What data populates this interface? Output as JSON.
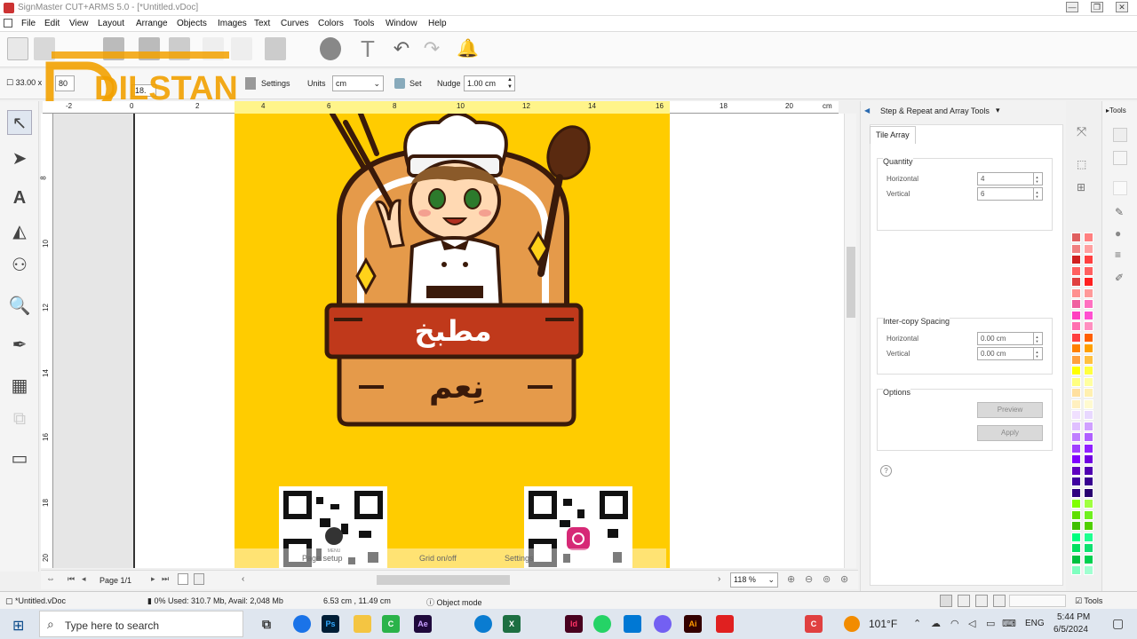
{
  "window": {
    "title": "SignMaster CUT+ARMS 5.0 - [*Untitled.vDoc]",
    "controls": [
      "—",
      "❐",
      "✕"
    ]
  },
  "menu": [
    "File",
    "Edit",
    "View",
    "Layout",
    "Arrange",
    "Objects",
    "Images",
    "Text",
    "Curves",
    "Colors",
    "Tools",
    "Window",
    "Help"
  ],
  "logo": {
    "text": "DILSTAN"
  },
  "property_bar": {
    "size_value": "33.00 x",
    "size_value2": "80",
    "size_value3": "18.",
    "settings_label": "Settings",
    "units_label": "Units",
    "units_value": "cm",
    "set_label": "Set",
    "nudge_label": "Nudge",
    "nudge_value": "1.00 cm"
  },
  "ruler": {
    "h_ticks": [
      "-2",
      "0",
      "2",
      "4",
      "6",
      "8",
      "10",
      "12",
      "14",
      "16",
      "18",
      "20",
      "cm"
    ],
    "v_ticks": [
      "8",
      "10",
      "12",
      "14",
      "16",
      "18",
      "20"
    ]
  },
  "design": {
    "title_line1": "مطبخ",
    "title_line2": "نِعم",
    "qr_menu_label": "MENU"
  },
  "canvas_overlay": {
    "label1": "Page setup",
    "label2": "Grid on/off",
    "label3": "Settings"
  },
  "bottom_nav": {
    "page_label": "Page 1/1",
    "zoom": "118 %"
  },
  "panel": {
    "header": "Step & Repeat and Array Tools",
    "tools_toggle": "Tools",
    "tab": "Tile Array",
    "quantity": {
      "label": "Quantity",
      "horizontal_label": "Horizontal",
      "horizontal_value": "4",
      "vertical_label": "Vertical",
      "vertical_value": "6"
    },
    "spacing": {
      "label": "Inter-copy Spacing",
      "horizontal_label": "Horizontal",
      "horizontal_value": "0.00 cm",
      "vertical_label": "Vertical",
      "vertical_value": "0.00 cm"
    },
    "options": {
      "label": "Options",
      "preview": "Preview",
      "apply": "Apply"
    },
    "help": "?"
  },
  "status": {
    "file": "*Untitled.vDoc",
    "memory": "0%  Used: 310.7 Mb, Avail: 2,048 Mb",
    "coords": "6.53 cm , 11.49 cm",
    "mode": "Object mode",
    "tools": "Tools"
  },
  "taskbar": {
    "search_placeholder": "Type here to search",
    "weather": "101°F",
    "lang": "ENG",
    "time": "5:44 PM",
    "date": "6/5/2024"
  },
  "colors": {
    "accent_yellow": "#ffcc00",
    "brown": "#8b4a1c",
    "red_banner": "#c0391b"
  }
}
